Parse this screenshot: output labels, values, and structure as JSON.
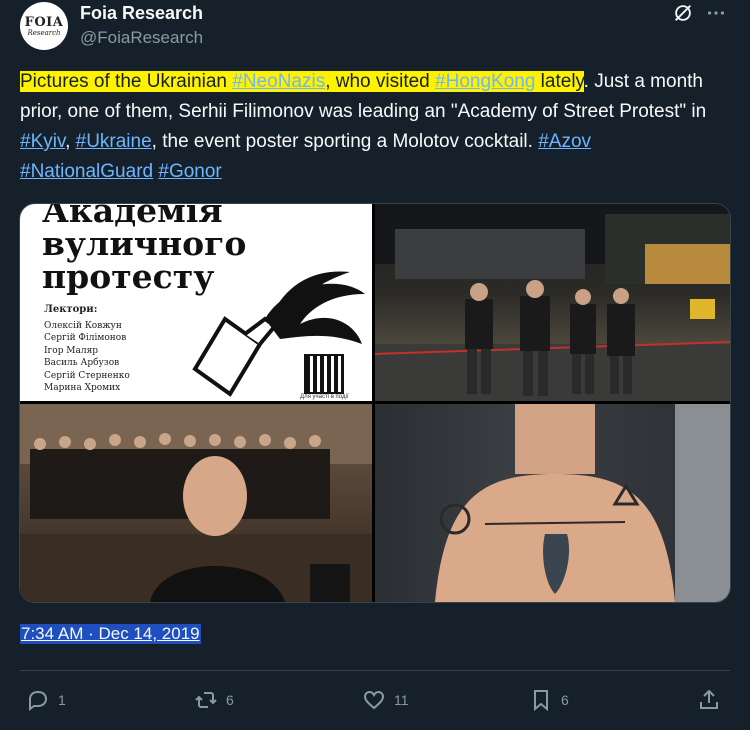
{
  "author": {
    "display_name": "Foia Research",
    "handle": "@FoiaResearch",
    "avatar_line1": "FOIA",
    "avatar_line2": "Research"
  },
  "tweet": {
    "seg1": "Pictures of the Ukrainian ",
    "tag_neonazis": "#NeoNazis",
    "seg2": ", who visited ",
    "tag_hongkong": "#HongKong",
    "seg3": " lately",
    "seg4": ". Just a month prior, one of them, Serhii Filimonov was leading an \"Academy of Street Protest\" in ",
    "tag_kyiv": "#Kyiv",
    "seg5": ", ",
    "tag_ukraine": "#Ukraine",
    "seg6": ", the event poster sporting a Molotov cocktail. ",
    "tag_azov": "#Azov",
    "tag_nationalguard": "#NationalGuard",
    "tag_gonor": "#Gonor"
  },
  "poster": {
    "title": "Академія вуличного протесту",
    "lectors_heading": "Лектори:",
    "lectors": [
      "Олексій Ковжун",
      "Сергій Філімонов",
      "Ігор Маляр",
      "Василь Арбузов",
      "Сергій Стерненко",
      "Марина Хромих"
    ],
    "footnote": "Для участі в події"
  },
  "timestamp": "7:34 AM · Dec 14, 2019",
  "actions": {
    "replies": "1",
    "retweets": "6",
    "likes": "11",
    "bookmarks": "6"
  },
  "colors": {
    "background": "#15202b",
    "text": "#f7f9f9",
    "muted": "#8b98a5",
    "link": "#6cb6ff",
    "highlight": "#fff200",
    "border": "#38444d"
  }
}
